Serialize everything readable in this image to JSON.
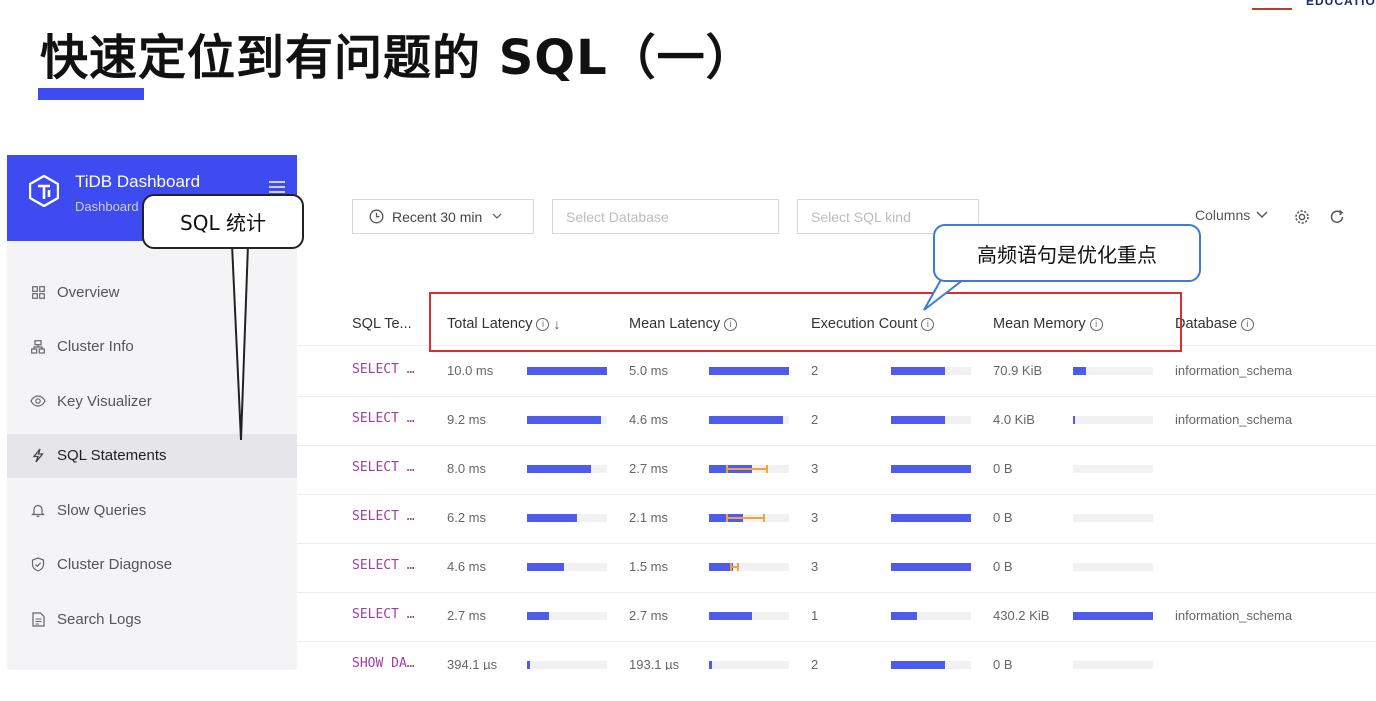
{
  "slide": {
    "title": "快速定位到有问题的 SQL（一）",
    "logo_text": "EDUCATIO"
  },
  "brand": {
    "name": "TiDB Dashboard",
    "subtitle": "Dashboard"
  },
  "nav": [
    {
      "label": "Overview",
      "icon": "grid-icon",
      "active": false
    },
    {
      "label": "Cluster Info",
      "icon": "cluster-icon",
      "active": false
    },
    {
      "label": "Key Visualizer",
      "icon": "eye-icon",
      "active": false
    },
    {
      "label": "SQL Statements",
      "icon": "lightning-icon",
      "active": true
    },
    {
      "label": "Slow Queries",
      "icon": "bell-icon",
      "active": false
    },
    {
      "label": "Cluster Diagnose",
      "icon": "shield-icon",
      "active": false
    },
    {
      "label": "Search Logs",
      "icon": "file-icon",
      "active": false
    }
  ],
  "filters": {
    "time_range": "Recent 30 min",
    "database_placeholder": "Select Database",
    "sql_kind_placeholder": "Select SQL kind",
    "columns_label": "Columns"
  },
  "columns": {
    "sql_text": "SQL Te...",
    "total_latency": "Total Latency",
    "mean_latency": "Mean Latency",
    "exec_count": "Execution Count",
    "mean_memory": "Mean Memory",
    "database": "Database"
  },
  "rows": [
    {
      "sql": "SELECT …",
      "total": "10.0 ms",
      "total_frac": 1.0,
      "mean": "5.0 ms",
      "mean_frac": 1.0,
      "mean_err": null,
      "count": "2",
      "count_frac": 0.67,
      "mem": "70.9 KiB",
      "mem_frac": 0.16,
      "db": "information_schema"
    },
    {
      "sql": "SELECT …",
      "total": "9.2 ms",
      "total_frac": 0.92,
      "mean": "4.6 ms",
      "mean_frac": 0.92,
      "mean_err": null,
      "count": "2",
      "count_frac": 0.67,
      "mem": "4.0 KiB",
      "mem_frac": 0.01,
      "db": "information_schema"
    },
    {
      "sql": "SELECT …",
      "total": "8.0 ms",
      "total_frac": 0.8,
      "mean": "2.7 ms",
      "mean_frac": 0.54,
      "mean_err": [
        0.22,
        0.72
      ],
      "count": "3",
      "count_frac": 1.0,
      "mem": "0 B",
      "mem_frac": 0,
      "db": ""
    },
    {
      "sql": "SELECT …",
      "total": "6.2 ms",
      "total_frac": 0.62,
      "mean": "2.1 ms",
      "mean_frac": 0.42,
      "mean_err": [
        0.22,
        0.69
      ],
      "count": "3",
      "count_frac": 1.0,
      "mem": "0 B",
      "mem_frac": 0,
      "db": ""
    },
    {
      "sql": "SELECT …",
      "total": "4.6 ms",
      "total_frac": 0.46,
      "mean": "1.5 ms",
      "mean_frac": 0.3,
      "mean_err": [
        0.28,
        0.36
      ],
      "count": "3",
      "count_frac": 1.0,
      "mem": "0 B",
      "mem_frac": 0,
      "db": ""
    },
    {
      "sql": "SELECT …",
      "total": "2.7 ms",
      "total_frac": 0.27,
      "mean": "2.7 ms",
      "mean_frac": 0.54,
      "mean_err": null,
      "count": "1",
      "count_frac": 0.33,
      "mem": "430.2 KiB",
      "mem_frac": 1.0,
      "db": "information_schema"
    },
    {
      "sql": "SHOW DA…",
      "total": "394.1 µs",
      "total_frac": 0.04,
      "mean": "193.1 µs",
      "mean_frac": 0.04,
      "mean_err": null,
      "count": "2",
      "count_frac": 0.67,
      "mem": "0 B",
      "mem_frac": 0,
      "db": ""
    }
  ],
  "callouts": {
    "sql_stats": "SQL 统计",
    "high_freq": "高频语句是优化重点"
  },
  "colors": {
    "accent": "#3d4bf0",
    "bar": "#4f5bed",
    "error_bar": "#f0a43a",
    "highlight_box": "#d62f2f",
    "sql_text": "#a23ea2"
  }
}
